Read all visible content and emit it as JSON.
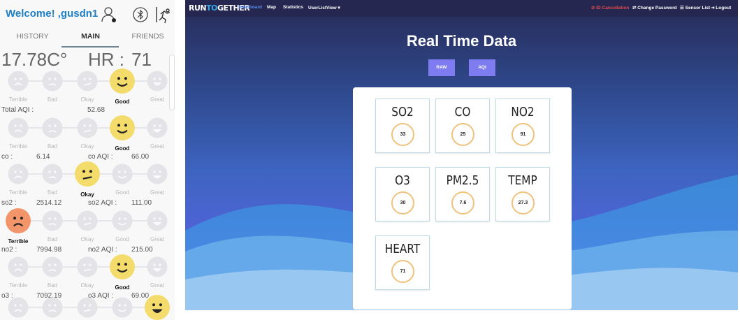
{
  "app": {
    "welcome": "Welcome! ,gusdn1",
    "icons": [
      "user-settings-icon",
      "bluetooth-icon",
      "running-icon"
    ],
    "tabs": [
      {
        "label": "HISTORY"
      },
      {
        "label": "MAIN",
        "active": true
      },
      {
        "label": "FRIENDS"
      }
    ],
    "temperature": "17.78C°",
    "hr_label": "HR :",
    "hr_value": "71",
    "face_labels": [
      "Terrible",
      "Bad",
      "Okay",
      "Good",
      "Great"
    ],
    "rows": [
      {
        "selected": 3,
        "label": "Total AQI :",
        "value": "52.68",
        "aqi_label": "",
        "aqi_value": ""
      },
      {
        "selected": 3,
        "label": "co :",
        "value": "6.14",
        "aqi_label": "co AQI :",
        "aqi_value": "66.00"
      },
      {
        "selected": 2,
        "label": "so2 :",
        "value": "2514.12",
        "aqi_label": "so2 AQI :",
        "aqi_value": "111.00"
      },
      {
        "selected": 0,
        "label": "no2 :",
        "value": "7994.98",
        "aqi_label": "no2 AQI :",
        "aqi_value": "215.00"
      },
      {
        "selected": 3,
        "label": "o3 :",
        "value": "7092.19",
        "aqi_label": "o3 AQI :",
        "aqi_value": "69.00"
      },
      {
        "selected": 4,
        "label": "",
        "value": "",
        "aqi_label": "",
        "aqi_value": ""
      }
    ],
    "colors": {
      "good": "#f3dc6b",
      "terrible": "#f2956a",
      "inactive": "#e4e4e8"
    }
  },
  "web": {
    "logo_run": "RUN",
    "logo_to": "TO",
    "logo_gether": "GETHER",
    "nav": [
      {
        "label": "Dashboard",
        "active": true
      },
      {
        "label": "Map"
      },
      {
        "label": "Statistics"
      },
      {
        "label": "UserListView ▾"
      }
    ],
    "nav_right": [
      {
        "label": "⊘ ID Cancellation",
        "danger": true
      },
      {
        "label": "⇄ Change Password"
      },
      {
        "label": "☰ Sensor List"
      },
      {
        "label": "⇥ Logout"
      }
    ],
    "title": "Real Time Data",
    "buttons": [
      "RAW",
      "AQI"
    ],
    "sensors": [
      {
        "name": "SO2",
        "value": "33"
      },
      {
        "name": "CO",
        "value": "25"
      },
      {
        "name": "NO2",
        "value": "91"
      },
      {
        "name": "O3",
        "value": "30"
      },
      {
        "name": "PM2.5",
        "value": "7.6"
      },
      {
        "name": "TEMP",
        "value": "27.3"
      },
      {
        "name": "HEART",
        "value": "71"
      }
    ]
  }
}
